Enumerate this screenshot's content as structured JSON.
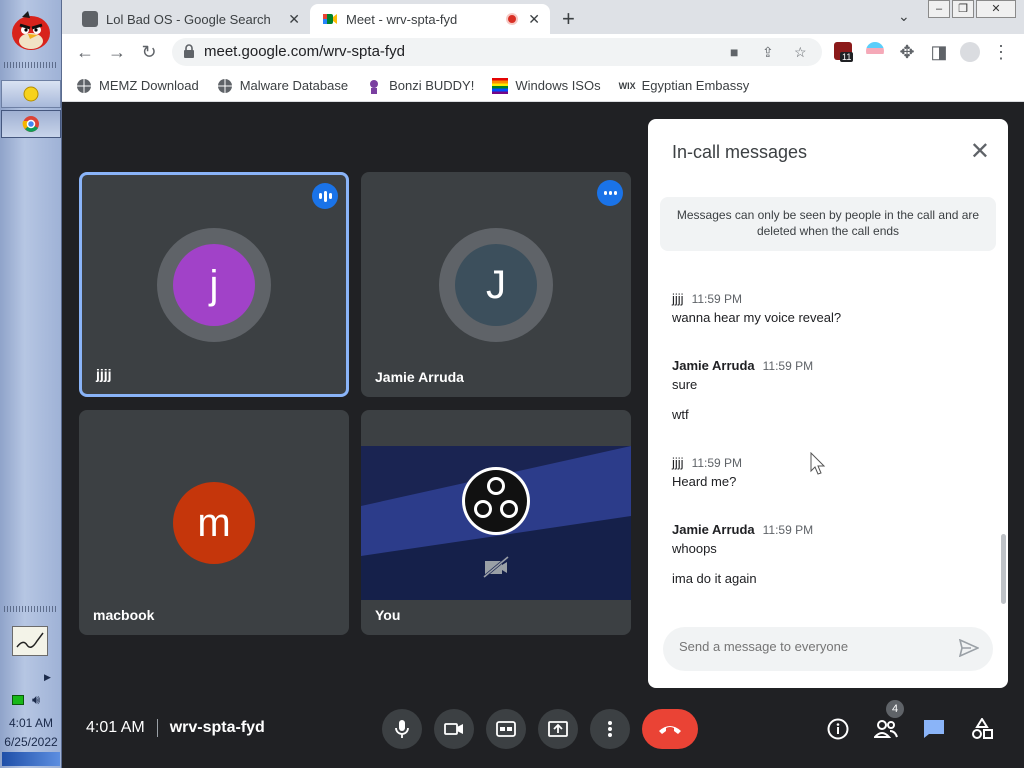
{
  "taskbar": {
    "time": "4:01 AM",
    "date": "6/25/2022",
    "items": [
      {
        "icon": "star-icon"
      },
      {
        "icon": "chrome-icon"
      }
    ]
  },
  "browser": {
    "tabs": [
      {
        "title": "Lol Bad OS - Google Search",
        "icon": "google-search-icon",
        "active": false
      },
      {
        "title": "Meet - wrv-spta-fyd",
        "icon": "meet-icon",
        "active": true,
        "recording": true
      }
    ],
    "url": "meet.google.com/wrv-spta-fyd",
    "extension_badge": "11",
    "bookmarks": [
      {
        "label": "MEMZ Download",
        "icon": "globe-icon"
      },
      {
        "label": "Malware Database",
        "icon": "globe-icon"
      },
      {
        "label": "Bonzi BUDDY!",
        "icon": "bonzi-icon"
      },
      {
        "label": "Windows ISOs",
        "icon": "rainbow-flag-icon"
      },
      {
        "label": "Egyptian Embassy",
        "icon": "wix-icon"
      }
    ]
  },
  "meet": {
    "tiles": [
      {
        "name": "jjjj",
        "initial": "j",
        "color": "#a142c8",
        "speaking": true
      },
      {
        "name": "Jamie Arruda",
        "initial": "J",
        "color": "#3c4f5c",
        "speaking": false
      },
      {
        "name": "macbook",
        "initial": "m",
        "color": "#c5360b",
        "speaking": false
      },
      {
        "name": "You",
        "initial": "",
        "color": "#1f2a5a",
        "speaking": false
      }
    ],
    "time": "4:01 AM",
    "meeting_code": "wrv-spta-fyd",
    "participants_count": "4"
  },
  "chat": {
    "title": "In-call messages",
    "notice": "Messages can only be seen by people in the call and are deleted when the call ends",
    "messages": [
      {
        "sender": "jjjj",
        "time": "11:59 PM",
        "lines": [
          "wanna hear my voice reveal?"
        ]
      },
      {
        "sender": "Jamie Arruda",
        "time": "11:59 PM",
        "lines": [
          "sure",
          "wtf"
        ]
      },
      {
        "sender": "jjjj",
        "time": "11:59 PM",
        "lines": [
          "Heard me?"
        ]
      },
      {
        "sender": "Jamie Arruda",
        "time": "11:59 PM",
        "lines": [
          "whoops",
          "ima do it again"
        ]
      }
    ],
    "placeholder": "Send a message to everyone"
  }
}
